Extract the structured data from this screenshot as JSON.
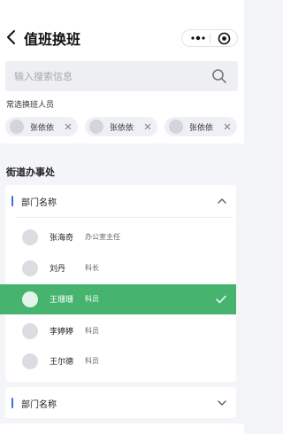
{
  "nav": {
    "title": "值班换班",
    "back_icon": "back-icon",
    "more_icon": "more-icon",
    "target_icon": "target-icon"
  },
  "search": {
    "placeholder": "输入搜索信息",
    "icon": "search-icon"
  },
  "frequent": {
    "label": "常选换班人员",
    "chips": [
      {
        "name": "张依依"
      },
      {
        "name": "张依依"
      },
      {
        "name": "张依依"
      }
    ]
  },
  "section": {
    "title": "街道办事处"
  },
  "departments": [
    {
      "name": "部门名称",
      "expanded": true,
      "members": [
        {
          "name": "张海奇",
          "role": "办公室主任",
          "selected": false
        },
        {
          "name": "刘丹",
          "role": "科长",
          "selected": false
        },
        {
          "name": "王珊珊",
          "role": "科员",
          "selected": true
        },
        {
          "name": "李婷婷",
          "role": "科员",
          "selected": false
        },
        {
          "name": "王尔德",
          "role": "科员",
          "selected": false
        }
      ]
    },
    {
      "name": "部门名称",
      "expanded": false,
      "members": []
    }
  ],
  "colors": {
    "accent_blue": "#3b6fde",
    "selected_green": "#46b46f",
    "background": "#f4f5f9"
  }
}
